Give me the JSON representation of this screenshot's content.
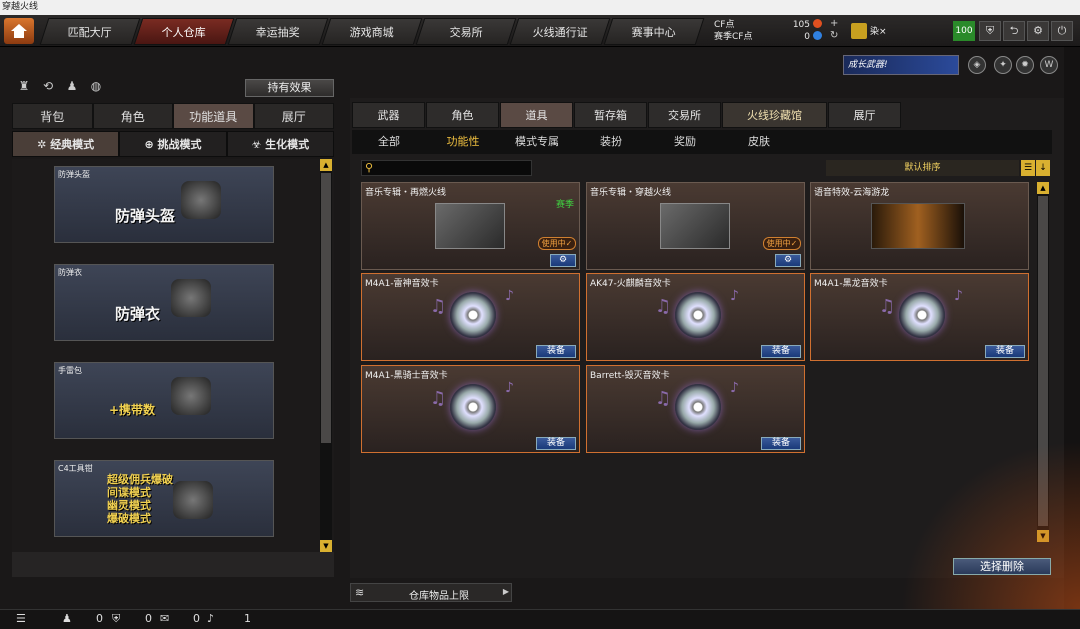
{
  "window": {
    "title": "穿越火线"
  },
  "topnav": {
    "tabs": [
      "匹配大厅",
      "个人仓库",
      "幸运抽奖",
      "游戏商城",
      "交易所",
      "火线通行证",
      "赛事中心"
    ],
    "active_tab": "个人仓库",
    "cf_label": "CF点",
    "season_cf_label": "赛季CF点",
    "cf_value": "105",
    "season_cf_value": "0",
    "plus": "+",
    "refresh": "↻",
    "username": "染×",
    "level": "100",
    "icons": [
      "shield-icon",
      "exit-icon",
      "restore-icon",
      "gear-icon",
      "power-icon"
    ]
  },
  "promo": {
    "banner": "成长武器!"
  },
  "left_panel": {
    "effect_button": "持有效果",
    "tabs": [
      "背包",
      "角色",
      "功能道具",
      "展厅"
    ],
    "active_tab": "功能道具",
    "modes": [
      "经典模式",
      "挑战模式",
      "生化模式"
    ],
    "active_mode": "经典模式",
    "items": [
      {
        "caption": "防弹头盔",
        "label": "防弹头盔"
      },
      {
        "caption": "防弹衣",
        "label": "防弹衣"
      },
      {
        "caption": "手雷包",
        "label": "+携带数"
      },
      {
        "caption": "C4工具钳",
        "lines": [
          "超级佣兵爆破",
          "间谍模式",
          "幽灵模式",
          "爆破模式"
        ]
      }
    ]
  },
  "right_panel": {
    "tabs": [
      "武器",
      "角色",
      "道具",
      "暂存箱",
      "交易所",
      "火线珍藏馆",
      "展厅"
    ],
    "active_tab": "道具",
    "sub_tabs": [
      "全部",
      "功能性",
      "模式专属",
      "装扮",
      "奖励",
      "皮肤"
    ],
    "active_sub_tab": "功能性",
    "search_placeholder": "",
    "sort_label": "默认排序",
    "cards": [
      {
        "title": "音乐专辑・再燃火线",
        "status": "使用中✓",
        "extra": "赛季",
        "action": "⚙"
      },
      {
        "title": "音乐专辑・穿越火线",
        "status": "使用中✓",
        "action": "⚙"
      },
      {
        "title": "语音特效-云海游龙"
      },
      {
        "title": "M4A1-雷神音效卡",
        "action": "装备"
      },
      {
        "title": "AK47-火麒麟音效卡",
        "action": "装备"
      },
      {
        "title": "M4A1-黑龙音效卡",
        "action": "装备"
      },
      {
        "title": "M4A1-黑骑士音效卡",
        "action": "装备"
      },
      {
        "title": "Barrett-毁灭音效卡",
        "action": "装备"
      }
    ],
    "delete_button": "选择删除",
    "storage_label": "仓库物品上限"
  },
  "statusbar": {
    "values": [
      "0",
      "0",
      "0",
      "1"
    ]
  }
}
